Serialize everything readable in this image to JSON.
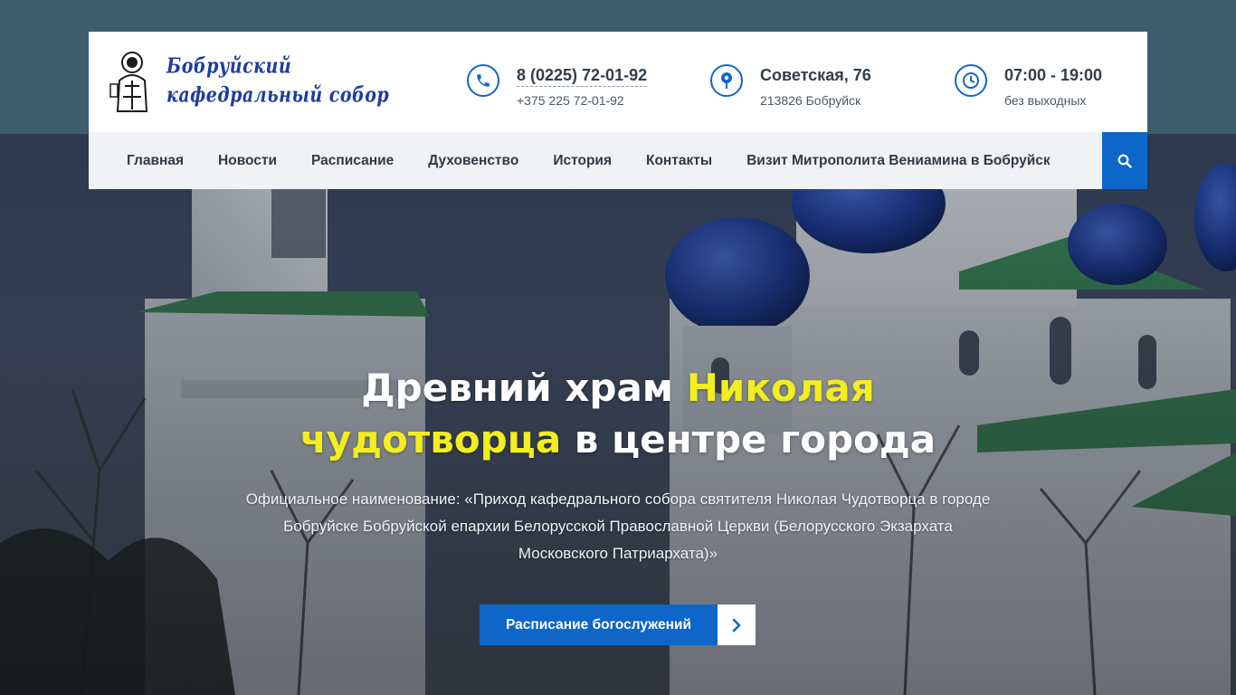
{
  "logo": {
    "line1": "Бобруйский",
    "line2": "кафедральный собор"
  },
  "contacts": {
    "phone": {
      "icon": "phone-icon",
      "main": "8 (0225) 72-01-92",
      "sub": "+375 225 72-01-92"
    },
    "address": {
      "icon": "map-pin-icon",
      "main": "Советская, 76",
      "sub": "213826 Бобруйск"
    },
    "hours": {
      "icon": "clock-icon",
      "main": "07:00 - 19:00",
      "sub": "без выходных"
    }
  },
  "nav": {
    "items": [
      {
        "label": "Главная"
      },
      {
        "label": "Новости"
      },
      {
        "label": "Расписание"
      },
      {
        "label": "Духовенство"
      },
      {
        "label": "История"
      },
      {
        "label": "Контакты"
      },
      {
        "label": "Визит Митрополита Вениамина в Бобруйск"
      }
    ],
    "search_icon": "search-icon"
  },
  "hero": {
    "title_part1": "Древний храм ",
    "title_highlight1": "Николая чудотворца",
    "title_part2": " в центре города",
    "description": "Официальное наименование: «Приход кафедрального собора святителя Николая Чудотворца в городе Бобруйске Бобруйской епархии Белорусской Православной Церкви (Белорусского Экзархата Московского Патриархата)»",
    "cta_label": "Расписание богослужений",
    "cta_icon": "chevron-right-icon"
  },
  "colors": {
    "accent": "#0d66c8",
    "highlight": "#f2ee1f",
    "top_band": "#3e5d6b",
    "logo_text": "#1e3d9e"
  }
}
